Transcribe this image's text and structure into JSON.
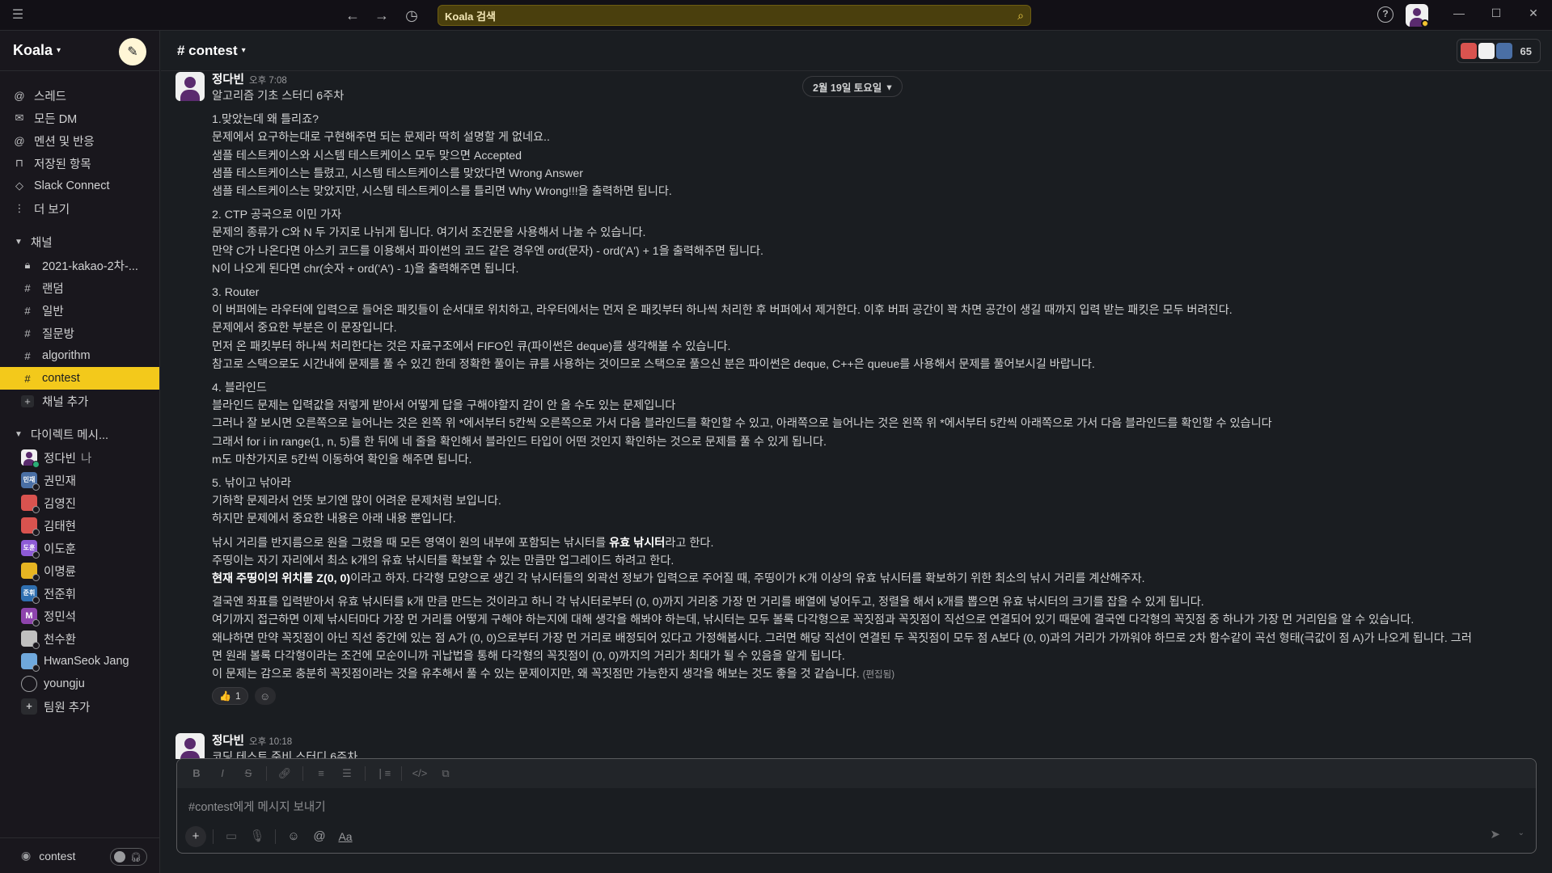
{
  "topbar": {
    "search_placeholder": "Koala 검색"
  },
  "sidebar": {
    "workspace": "Koala",
    "nav": [
      {
        "label": "스레드",
        "icon": "threads-icon"
      },
      {
        "label": "모든 DM",
        "icon": "dm-icon"
      },
      {
        "label": "멘션 및 반응",
        "icon": "mention-icon"
      },
      {
        "label": "저장된 항목",
        "icon": "bookmark-icon"
      },
      {
        "label": "Slack Connect",
        "icon": "connect-icon"
      },
      {
        "label": "더 보기",
        "icon": "more-icon"
      }
    ],
    "channels_title": "채널",
    "channels": [
      {
        "label": "2021-kakao-2차-...",
        "icon": "lock-icon"
      },
      {
        "label": "랜덤",
        "icon": "hash-icon"
      },
      {
        "label": "일반",
        "icon": "hash-icon"
      },
      {
        "label": "질문방",
        "icon": "hash-icon"
      },
      {
        "label": "algorithm",
        "icon": "hash-icon"
      },
      {
        "label": "contest",
        "icon": "hash-icon",
        "active": true
      },
      {
        "label": "채널 추가",
        "icon": "plus-icon"
      }
    ],
    "dm_title": "다이렉트 메시...",
    "dms": [
      {
        "label": "정다빈",
        "sub": "나",
        "color": "#5a2b6e"
      },
      {
        "label": "권민재",
        "avatar_text": "민재",
        "color": "#4a6fa5"
      },
      {
        "label": "김영진",
        "color": "#d9534f"
      },
      {
        "label": "김태현",
        "color": "#d9534f"
      },
      {
        "label": "이도훈",
        "avatar_text": "도훈",
        "color": "#8e5bd6"
      },
      {
        "label": "이명륜",
        "color": "#e6b422"
      },
      {
        "label": "전준휘",
        "avatar_text": "준휘",
        "color": "#2f6fb0"
      },
      {
        "label": "정민석",
        "avatar_text": "M",
        "color": "#8e44ad"
      },
      {
        "label": "천수환",
        "color": "#c0c0c0"
      },
      {
        "label": "HwanSeok Jang",
        "color": "#6fa8dc"
      },
      {
        "label": "youngju",
        "color": "#19171d"
      },
      {
        "label": "팀원 추가",
        "icon": "plus-icon"
      }
    ],
    "footer_label": "contest"
  },
  "channel": {
    "name": "# contest",
    "member_count": "65"
  },
  "date_divider": "2월 19일 토요일",
  "messages": [
    {
      "author": "정다빈",
      "time": "오후 7:08",
      "lines": [
        {
          "text": "알고리즘 기초 스터디 6주차"
        },
        {
          "gap": true
        },
        {
          "text": "1.맞았는데 왜 틀리죠?"
        },
        {
          "text": "문제에서 요구하는대로 구현해주면 되는 문제라 딱히 설명할 게 없네요.."
        },
        {
          "text": "샘플 테스트케이스와 시스템 테스트케이스 모두 맞으면 Accepted"
        },
        {
          "text": "샘플 테스트케이스는 틀렸고, 시스템 테스트케이스를 맞았다면 Wrong Answer"
        },
        {
          "text": "샘플 테스트케이스는 맞았지만, 시스템 테스트케이스를 틀리면 Why Wrong!!!을 출력하면 됩니다."
        },
        {
          "gap": true
        },
        {
          "text": "2. CTP 공국으로 이민 가자"
        },
        {
          "text": "문제의 종류가 C와 N 두 가지로 나뉘게 됩니다. 여기서 조건문을 사용해서 나눌 수 있습니다."
        },
        {
          "text": "만약 C가 나온다면 아스키 코드를 이용해서 파이썬의 코드 같은 경우엔 ord(문자) - ord('A') + 1을 출력해주면 됩니다."
        },
        {
          "text": "N이 나오게 된다면 chr(숫자 + ord('A') - 1)을 출력해주면 됩니다."
        },
        {
          "gap": true
        },
        {
          "text": "3. Router"
        },
        {
          "text": "이 버퍼에는 라우터에 입력으로 들어온 패킷들이 순서대로 위치하고, 라우터에서는 먼저 온 패킷부터 하나씩 처리한 후 버퍼에서 제거한다. 이후 버퍼 공간이 꽉 차면 공간이 생길 때까지 입력 받는 패킷은 모두 버려진다."
        },
        {
          "text": "문제에서 중요한 부분은 이 문장입니다."
        },
        {
          "text": "먼저 온 패킷부터 하나씩 처리한다는 것은 자료구조에서 FIFO인 큐(파이썬은 deque)를 생각해볼 수 있습니다."
        },
        {
          "text": "참고로 스택으로도 시간내에 문제를 풀 수 있긴 한데 정확한 풀이는 큐를 사용하는 것이므로 스택으로 풀으신 분은 파이썬은 deque, C++은 queue를 사용해서 문제를 풀어보시길 바랍니다."
        },
        {
          "gap": true
        },
        {
          "text": "4.  블라인드"
        },
        {
          "text": "블라인드 문제는 입력값을 저렇게 받아서 어떻게 답을 구해야할지 감이 안 올 수도 있는 문제입니다"
        },
        {
          "text": "그러나 잘 보시면 오른쪽으로 늘어나는 것은 왼쪽 위 *에서부터 5칸씩 오른쪽으로 가서 다음 블라인드를 확인할 수 있고, 아래쪽으로 늘어나는 것은 왼쪽 위 *에서부터 5칸씩 아래쪽으로 가서 다음 블라인드를 확인할 수 있습니다"
        },
        {
          "text": "그래서 for i in range(1, n, 5)를 한 뒤에 네 줄을 확인해서 블라인드 타입이 어떤 것인지 확인하는 것으로 문제를 풀 수 있게 됩니다."
        },
        {
          "text": "m도 마찬가지로 5칸씩 이동하여 확인을 해주면 됩니다."
        },
        {
          "gap": true
        },
        {
          "text": "5. 낚이고 낚아라"
        },
        {
          "text": "기하학 문제라서 언뜻 보기엔 많이 어려운 문제처럼 보입니다."
        },
        {
          "text": "하지만 문제에서 중요한 내용은 아래 내용 뿐입니다."
        },
        {
          "gap": true
        },
        {
          "pre": "낚시 거리를 반지름으로 원을 그렸을 때 모든 영역이 원의 내부에 포함되는 낚시터를 ",
          "bold": "유효 낚시터",
          "post": "라고 한다."
        },
        {
          "text": "주띵이는 자기 자리에서 최소 k개의 유효 낚시터를 확보할 수 있는 만큼만 업그레이드 하려고 한다."
        },
        {
          "pre": "",
          "bold": "현재 주띵이의 위치를 Z(0, 0)",
          "post": "이라고 하자. 다각형 모양으로 생긴 각 낚시터들의 외곽선 정보가 입력으로 주어질 때, 주띵이가 K개 이상의 유효 낚시터를 확보하기 위한 최소의 낚시 거리를 계산해주자."
        },
        {
          "gap": true
        },
        {
          "text": "결국엔 좌표를 입력받아서 유효 낚시터를 k개 만큼 만드는 것이라고 하니 각 낚시터로부터 (0, 0)까지 거리중 가장 먼 거리를 배열에 넣어두고, 정렬을 해서 k개를 뽑으면 유효 낚시터의 크기를 잡을 수 있게 됩니다."
        },
        {
          "text": "여기까지 접근하면 이제 낚시터마다 가장 먼 거리를 어떻게 구해야 하는지에 대해 생각을 해봐야 하는데, 낚시터는 모두 볼록 다각형으로 꼭짓점과 꼭짓점이 직선으로 연결되어 있기 때문에 결국엔 다각형의 꼭짓점 중 하나가 가장 먼 거리임을 알 수 있습니다."
        },
        {
          "text": "왜냐하면 만약 꼭짓점이 아닌 직선 중간에 있는 점 A가 (0, 0)으로부터 가장 먼 거리로 배정되어 있다고 가정해봅시다. 그러면 해당 직선이 연결된 두 꼭짓점이 모두 점 A보다 (0, 0)과의 거리가 가까워야 하므로 2차 함수같이 곡선 형태(극값이 점 A)가 나오게 됩니다. 그러"
        },
        {
          "text": "면 원래 볼록 다각형이라는 조건에 모순이니까 귀납법을 통해 다각형의 꼭짓점이 (0, 0)까지의 거리가 최대가 될 수 있음을 알게 됩니다."
        },
        {
          "text": "이 문제는 감으로 충분히 꼭짓점이라는 것을 유추해서 풀 수 있는 문제이지만, 왜 꼭짓점만 가능한지 생각을 해보는 것도 좋을 것 같습니다.",
          "edited": "(편집됨)"
        }
      ],
      "reaction": {
        "emoji": "👍",
        "count": "1"
      }
    },
    {
      "author": "정다빈",
      "time": "오후 10:18",
      "lines": [
        {
          "text": "코딩 테스트 준비 스터디 6주차"
        }
      ]
    }
  ],
  "composer": {
    "placeholder": "#contest에게 메시지 보내기"
  }
}
